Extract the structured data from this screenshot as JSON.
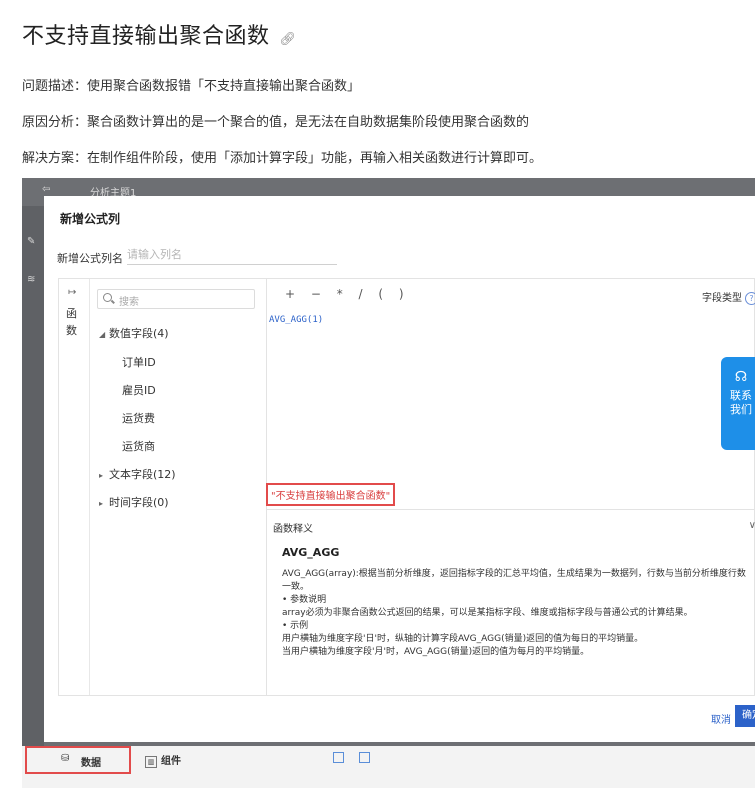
{
  "doc": {
    "title": "不支持直接输出聚合函数",
    "anchor_icon": "link-icon",
    "problem": "问题描述：使用聚合函数报错「不支持直接输出聚合函数」",
    "cause": "原因分析：聚合函数计算出的是一个聚合的值，是无法在自助数据集阶段使用聚合函数的",
    "solution": "解决方案：在制作组件阶段，使用「添加计算字段」功能，再输入相关函数进行计算即可。"
  },
  "screenshot": {
    "background_tab": "分析主题1",
    "dialog": {
      "title": "新增公式列",
      "name_label": "新增公式列名",
      "name_placeholder": "请输入列名",
      "func_tab_label": "函数",
      "search_placeholder": "搜索",
      "tree": [
        {
          "label": "数值字段(4)",
          "expanded": true,
          "children": [
            "订单ID",
            "雇员ID",
            "运货费",
            "运货商"
          ]
        },
        {
          "label": "文本字段(12)",
          "expanded": false
        },
        {
          "label": "时间字段(0)",
          "expanded": false
        }
      ],
      "operators": "+ − * / ( )",
      "field_type_label": "字段类型",
      "formula": "AVG_AGG(1)",
      "error": "\"不支持直接输出聚合函数\"",
      "contact": {
        "line1": "联系",
        "line2": "我们"
      },
      "doc_section_title": "函数释义",
      "function_name": "AVG_AGG",
      "function_desc": [
        "AVG_AGG(array):根据当前分析维度，返回指标字段的汇总平均值，生成结果为一数据列，行数与当前分析维度行数一致。",
        "• 参数说明",
        "array必须为非聚合函数公式返回的结果，可以是某指标字段、维度或指标字段与普通公式的计算结果。",
        "• 示例",
        "用户横轴为维度字段'日'时，纵轴的计算字段AVG_AGG(销量)返回的值为每日的平均销量。",
        "当用户横轴为维度字段'月'时，AVG_AGG(销量)返回的值为每月的平均销量。"
      ],
      "cancel_label": "取消",
      "ok_label": "确定"
    },
    "bottom_bar": {
      "data_tab": "数据",
      "component_tab": "组件"
    }
  }
}
